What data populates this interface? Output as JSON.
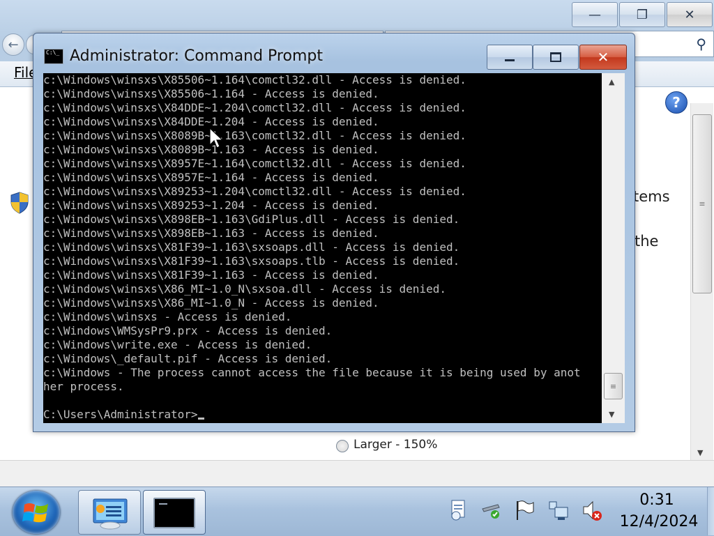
{
  "background_window": {
    "menu": {
      "file": "File"
    },
    "text_fragment_1": "tems",
    "text_fragment_2": "the",
    "radio_option_label": "Larger - 150%",
    "caption": {
      "minimize": "—",
      "restore": "❐",
      "close": "✕"
    }
  },
  "cmd_window": {
    "title": "Administrator: Command Prompt",
    "icon_text": "C:\\_",
    "close_glyph": "✕",
    "output_lines": [
      "c:\\Windows\\winsxs\\X85506~1.164\\comctl32.dll - Access is denied.",
      "c:\\Windows\\winsxs\\X85506~1.164 - Access is denied.",
      "c:\\Windows\\winsxs\\X84DDE~1.204\\comctl32.dll - Access is denied.",
      "c:\\Windows\\winsxs\\X84DDE~1.204 - Access is denied.",
      "c:\\Windows\\winsxs\\X8089B~1.163\\comctl32.dll - Access is denied.",
      "c:\\Windows\\winsxs\\X8089B~1.163 - Access is denied.",
      "c:\\Windows\\winsxs\\X8957E~1.164\\comctl32.dll - Access is denied.",
      "c:\\Windows\\winsxs\\X8957E~1.164 - Access is denied.",
      "c:\\Windows\\winsxs\\X89253~1.204\\comctl32.dll - Access is denied.",
      "c:\\Windows\\winsxs\\X89253~1.204 - Access is denied.",
      "c:\\Windows\\winsxs\\X898EB~1.163\\GdiPlus.dll - Access is denied.",
      "c:\\Windows\\winsxs\\X898EB~1.163 - Access is denied.",
      "c:\\Windows\\winsxs\\X81F39~1.163\\sxsoaps.dll - Access is denied.",
      "c:\\Windows\\winsxs\\X81F39~1.163\\sxsoaps.tlb - Access is denied.",
      "c:\\Windows\\winsxs\\X81F39~1.163 - Access is denied.",
      "c:\\Windows\\winsxs\\X86_MI~1.0_N\\sxsoa.dll - Access is denied.",
      "c:\\Windows\\winsxs\\X86_MI~1.0_N - Access is denied.",
      "c:\\Windows\\winsxs - Access is denied.",
      "c:\\Windows\\WMSysPr9.prx - Access is denied.",
      "c:\\Windows\\write.exe - Access is denied.",
      "c:\\Windows\\_default.pif - Access is denied.",
      "c:\\Windows - The process cannot access the file because it is being used by anot",
      "her process."
    ],
    "prompt": "C:\\Users\\Administrator>"
  },
  "taskbar": {
    "clock_time": "0:31",
    "clock_date": "12/4/2024",
    "tray_icons": [
      "action-center-icon",
      "power-icon",
      "flag-icon",
      "network-icon",
      "volume-muted-icon"
    ]
  },
  "colors": {
    "console_bg": "#000000",
    "console_text": "#c0c0c0",
    "close_button": "#c8401f",
    "taskbar": "#a9c2de"
  }
}
